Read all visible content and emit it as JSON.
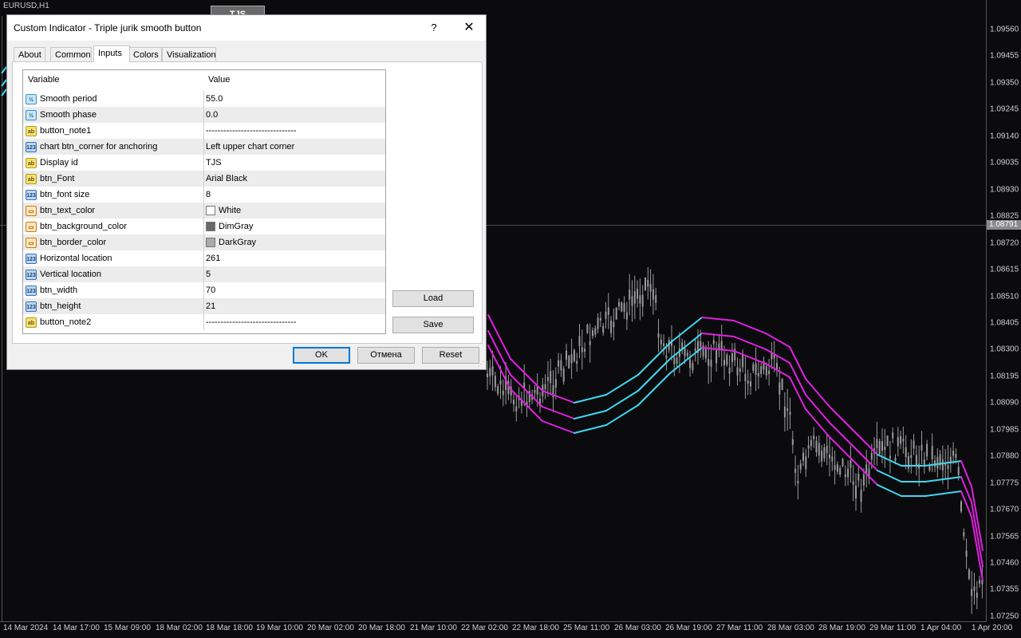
{
  "chart": {
    "symbol": "EURUSD,H1",
    "button_text": "TJS",
    "current_price": "1.08791",
    "price_levels": [
      "1.09560",
      "1.09455",
      "1.09350",
      "1.09245",
      "1.09140",
      "1.09035",
      "1.08930",
      "1.08825",
      "1.08720",
      "1.08615",
      "1.08510",
      "1.08405",
      "1.08300",
      "1.08195",
      "1.08090",
      "1.07985",
      "1.07880",
      "1.07775",
      "1.07670",
      "1.07565",
      "1.07460",
      "1.07355",
      "1.07250"
    ],
    "time_labels": [
      "14 Mar 2024",
      "14 Mar 17:00",
      "15 Mar 09:00",
      "18 Mar 02:00",
      "18 Mar 18:00",
      "19 Mar 10:00",
      "20 Mar 02:00",
      "20 Mar 18:00",
      "21 Mar 10:00",
      "22 Mar 02:00",
      "22 Mar 18:00",
      "25 Mar 11:00",
      "26 Mar 03:00",
      "26 Mar 19:00",
      "27 Mar 11:00",
      "28 Mar 03:00",
      "28 Mar 19:00",
      "29 Mar 11:00",
      "1 Apr 04:00",
      "1 Apr 20:00"
    ],
    "colors": {
      "background": "#0b0b0e",
      "candles": "#9a9a9a",
      "band_up": "#3fd8f0",
      "band_down": "#e020e0"
    }
  },
  "dialog": {
    "title": "Custom Indicator - Triple jurik smooth button",
    "help": "?",
    "close": "✕",
    "tabs": [
      "About",
      "Common",
      "Inputs",
      "Colors",
      "Visualization"
    ],
    "active_tab": "Inputs",
    "columns": {
      "variable": "Variable",
      "value": "Value"
    },
    "params": [
      {
        "type": "double",
        "icon": "½",
        "name": "Smooth period",
        "value": "55.0"
      },
      {
        "type": "double",
        "icon": "½",
        "name": "Smooth phase",
        "value": "0.0"
      },
      {
        "type": "string",
        "icon": "ab",
        "name": "button_note1",
        "value": "-------------------------------"
      },
      {
        "type": "int",
        "icon": "123",
        "name": "chart btn_corner for anchoring",
        "value": "Left upper chart corner"
      },
      {
        "type": "string",
        "icon": "ab",
        "name": "Display id",
        "value": "TJS"
      },
      {
        "type": "string",
        "icon": "ab",
        "name": "btn_Font",
        "value": "Arial Black"
      },
      {
        "type": "int",
        "icon": "123",
        "name": "btn_font size",
        "value": "8"
      },
      {
        "type": "color",
        "icon": "▭",
        "name": "btn_text_color",
        "value": "White",
        "swatch": "#ffffff"
      },
      {
        "type": "color",
        "icon": "▭",
        "name": "btn_background_color",
        "value": "DimGray",
        "swatch": "#696969"
      },
      {
        "type": "color",
        "icon": "▭",
        "name": "btn_border_color",
        "value": "DarkGray",
        "swatch": "#a9a9a9"
      },
      {
        "type": "int",
        "icon": "123",
        "name": "Horizontal location",
        "value": "261"
      },
      {
        "type": "int",
        "icon": "123",
        "name": "Vertical location",
        "value": "5"
      },
      {
        "type": "int",
        "icon": "123",
        "name": "btn_width",
        "value": "70"
      },
      {
        "type": "int",
        "icon": "123",
        "name": "btn_height",
        "value": "21"
      },
      {
        "type": "string",
        "icon": "ab",
        "name": "button_note2",
        "value": "-------------------------------"
      }
    ],
    "buttons": {
      "load": "Load",
      "save": "Save",
      "ok": "OK",
      "cancel": "Отмена",
      "reset": "Reset"
    }
  }
}
